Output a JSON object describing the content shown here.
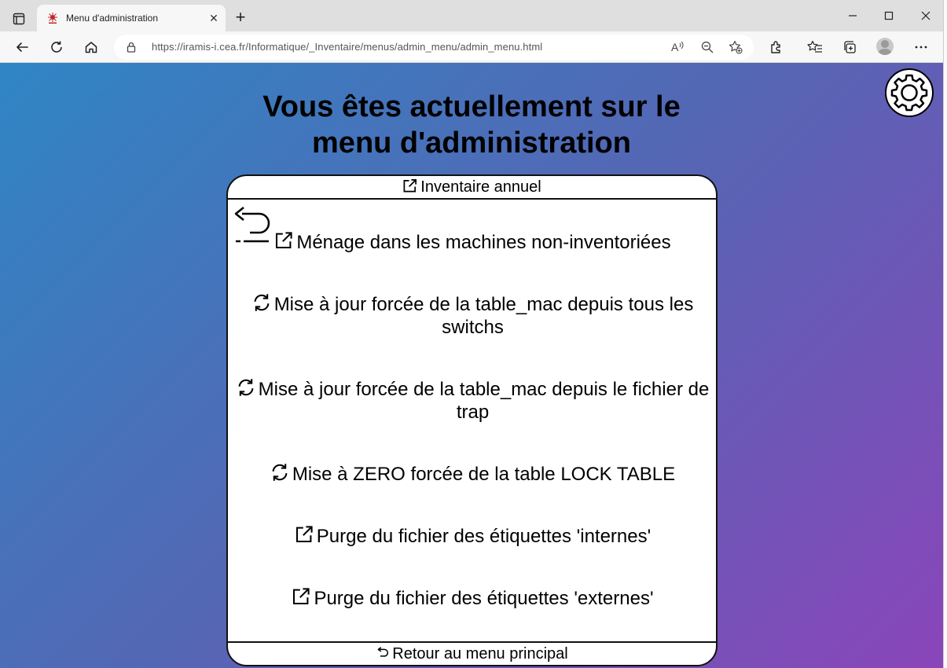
{
  "browser": {
    "tab_title": "Menu d'administration",
    "url": "https://iramis-i.cea.fr/Informatique/_Inventaire/menus/admin_menu/admin_menu.html"
  },
  "page": {
    "title_line1": "Vous êtes actuellement sur le",
    "title_line2": "menu d'administration"
  },
  "panel": {
    "top_link": "Inventaire annuel",
    "bottom_link": "Retour au menu principal",
    "items": [
      {
        "label": "Ménage dans les machines non-inventoriées",
        "icon": "external-link-icon"
      },
      {
        "label": "Mise à jour forcée de la table_mac depuis tous les switchs",
        "icon": "refresh-icon"
      },
      {
        "label": "Mise à jour forcée de la table_mac depuis le fichier de trap",
        "icon": "refresh-icon"
      },
      {
        "label": "Mise à ZERO forcée de la table LOCK TABLE",
        "icon": "refresh-icon"
      },
      {
        "label": "Purge du fichier des étiquettes 'internes'",
        "icon": "external-link-icon"
      },
      {
        "label": "Purge du fichier des étiquettes 'externes'",
        "icon": "external-link-icon"
      }
    ]
  }
}
